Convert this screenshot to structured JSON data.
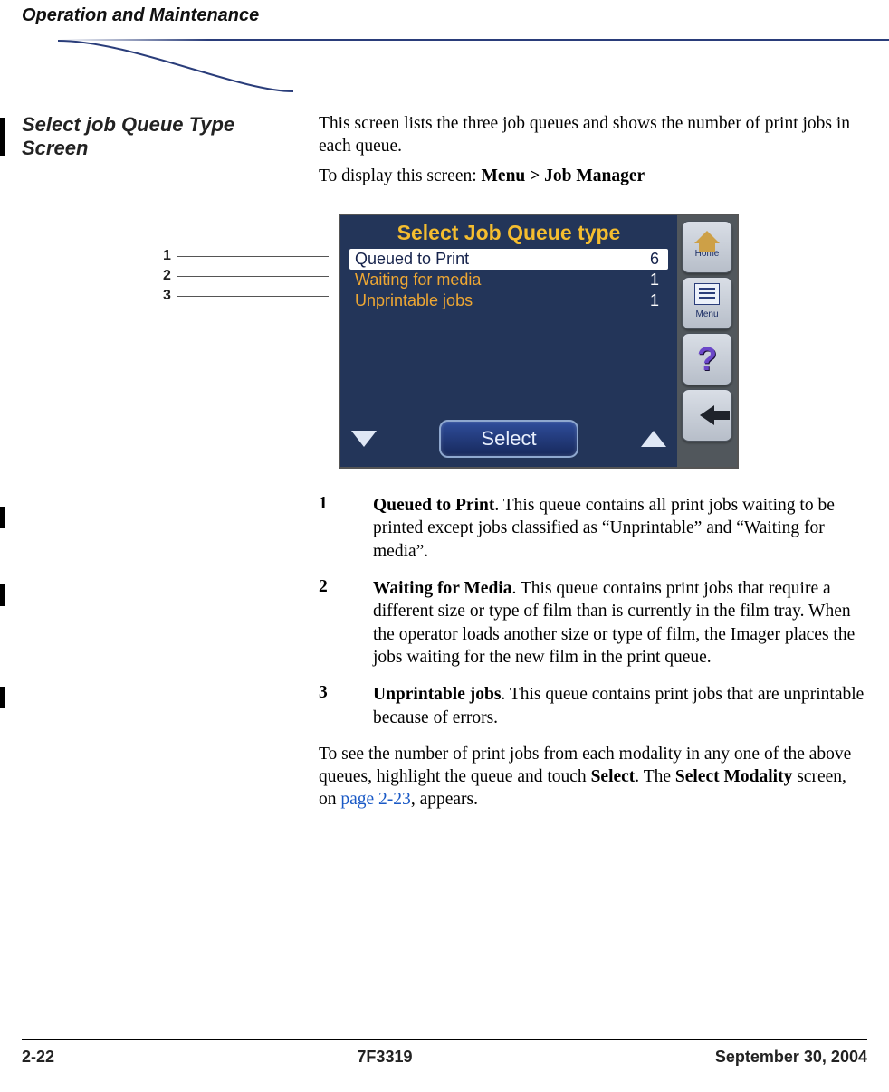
{
  "header": {
    "section": "Operation and Maintenance"
  },
  "sideHeading": "Select job Queue Type Screen",
  "intro": {
    "line1": "This screen lists the three job queues and shows the number of print jobs in each queue.",
    "line2_prefix": "To display this screen: ",
    "line2_path": "Menu > Job Manager"
  },
  "callouts": {
    "n1": "1",
    "n2": "2",
    "n3": "3"
  },
  "device": {
    "title": "Select Job Queue type",
    "rows": [
      {
        "label": "Queued to Print",
        "count": "6"
      },
      {
        "label": "Waiting for media",
        "count": "1"
      },
      {
        "label": "Unprintable jobs",
        "count": "1"
      }
    ],
    "select": "Select",
    "side": {
      "home": "Home",
      "menu": "Menu"
    }
  },
  "items": [
    {
      "n": "1",
      "term": "Queued to Print",
      "desc": ". This queue contains all print jobs waiting to be printed except jobs classified as “Unprintable” and “Waiting for media”."
    },
    {
      "n": "2",
      "term": "Waiting for Media",
      "desc": ". This queue contains print jobs that require a different size or type of film than is currently in the film tray. When the operator loads another size or type of film, the Imager places the jobs waiting for the new film in the print queue."
    },
    {
      "n": "3",
      "term": "Unprintable jobs",
      "desc": ". This queue contains print jobs that are unprintable because of errors."
    }
  ],
  "closing": {
    "pre": "To see the number of print jobs from each modality in any one of the above queues, highlight the queue and touch ",
    "b1": "Select",
    "mid": ". The ",
    "b2": "Select Modality",
    "post1": " screen, on ",
    "link": "page 2-23",
    "post2": ", appears."
  },
  "footer": {
    "left": "2-22",
    "center": "7F3319",
    "right": "September 30, 2004"
  }
}
